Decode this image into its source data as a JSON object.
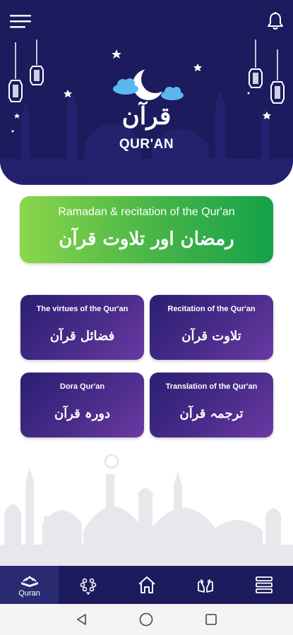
{
  "header": {
    "title_arabic": "قرآن",
    "title_english": "QUR'AN",
    "menu_icon": "hamburger-menu-icon",
    "notification_icon": "bell-icon"
  },
  "banner": {
    "title_english": "Ramadan & recitation of the Qur'an",
    "title_urdu": "رمضان اور تلاوت قرآن"
  },
  "cards": [
    {
      "title_english": "The virtues of the Qur'an",
      "title_urdu": "فضائل قرآن"
    },
    {
      "title_english": "Recitation of the Qur'an",
      "title_urdu": "تلاوت قرآن"
    },
    {
      "title_english": "Dora Qur'an",
      "title_urdu": "دورہ قرآن"
    },
    {
      "title_english": "Translation of the Qur'an",
      "title_urdu": "ترجمہ قرآن"
    }
  ],
  "bottom_nav": {
    "items": [
      {
        "label": "Quran",
        "icon": "quran-book-icon",
        "active": true
      },
      {
        "label": "",
        "icon": "prayer-beads-icon",
        "active": false
      },
      {
        "label": "",
        "icon": "home-icon",
        "active": false
      },
      {
        "label": "",
        "icon": "praying-hands-icon",
        "active": false
      },
      {
        "label": "",
        "icon": "list-menu-icon",
        "active": false
      }
    ]
  },
  "system_nav": {
    "items": [
      "back-icon",
      "home-circle-icon",
      "recents-square-icon"
    ]
  },
  "colors": {
    "header_bg": "#1b1b5e",
    "banner_gradient_start": "#8cd64a",
    "banner_gradient_end": "#14a24a",
    "card_gradient_start": "#2a1f73",
    "card_gradient_end": "#6b3aa3",
    "nav_bg": "#1b1b5e"
  }
}
